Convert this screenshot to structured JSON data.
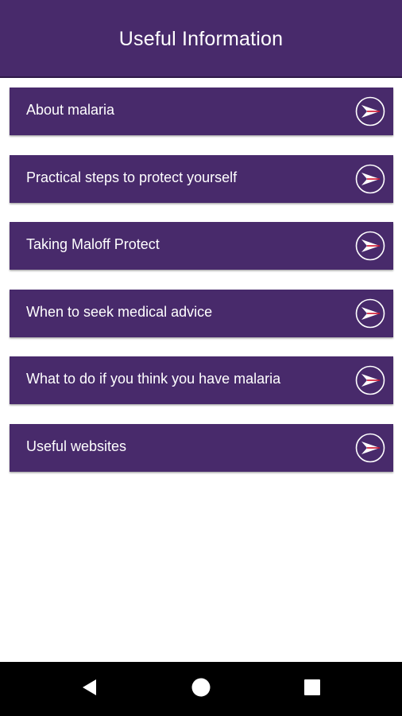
{
  "header": {
    "title": "Useful Information"
  },
  "menu": {
    "items": [
      {
        "label": "About malaria"
      },
      {
        "label": "Practical steps to protect yourself"
      },
      {
        "label": "Taking Maloff Protect"
      },
      {
        "label": "When to seek medical advice"
      },
      {
        "label": "What to do if you think you have malaria"
      },
      {
        "label": "Useful websites"
      }
    ],
    "item_icon": "arrow-right-circle-icon"
  },
  "navigation": {
    "back_icon": "back-triangle-icon",
    "home_icon": "home-circle-icon",
    "recents_icon": "recents-square-icon"
  },
  "colors": {
    "primary": "#482a6b",
    "icon_accent": "#d0102c",
    "background": "#ffffff",
    "nav_bar": "#000000"
  }
}
